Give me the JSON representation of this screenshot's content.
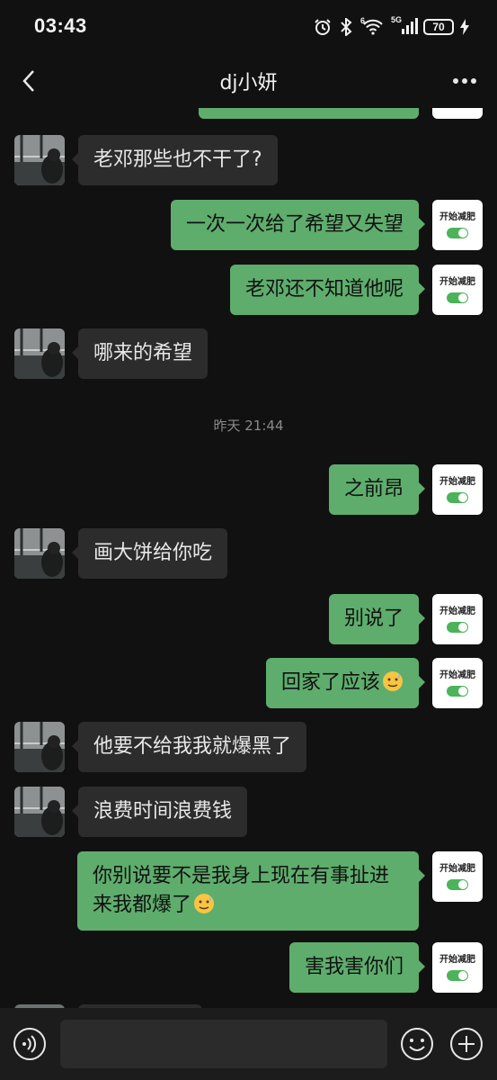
{
  "status_bar": {
    "time": "03:43",
    "signal_label": "5G",
    "wifi_label": "6",
    "battery_level": "70",
    "icons": [
      "alarm-icon",
      "bluetooth-icon",
      "wifi-icon",
      "cellular-signal-icon",
      "battery-icon",
      "charging-icon"
    ]
  },
  "header": {
    "title": "dj小妍",
    "back_icon": "chevron-left-icon",
    "more_icon": "more-dots-icon"
  },
  "contact_app_avatar": {
    "label": "开始减肥",
    "toggle_on": true
  },
  "messages": [
    {
      "side": "in",
      "text": "老邓那些也不干了?"
    },
    {
      "side": "out",
      "text": "一次一次给了希望又失望"
    },
    {
      "side": "out",
      "text": "老邓还不知道他呢"
    },
    {
      "side": "in",
      "text": "哪来的希望"
    },
    {
      "side": "out",
      "text": "之前昂"
    },
    {
      "side": "in",
      "text": "画大饼给你吃"
    },
    {
      "side": "out",
      "text": "别说了"
    },
    {
      "side": "out",
      "text": "回家了应该",
      "emoji": "sweat-smile-emoji"
    },
    {
      "side": "in",
      "text": "他要不给我我就爆黑了"
    },
    {
      "side": "in",
      "text": "浪费时间浪费钱"
    },
    {
      "side": "out",
      "text": "你别说要不是我身上现在有事扯进来我都爆了",
      "emoji": "sweat-smile-emoji"
    },
    {
      "side": "out",
      "text": "害我害你们"
    }
  ],
  "timestamp": "昨天 21:44",
  "input_bar": {
    "value": "",
    "voice_icon": "voice-icon",
    "emoji_icon": "smiley-icon",
    "plus_icon": "plus-icon"
  },
  "colors": {
    "background": "#111111",
    "incoming_bubble": "#2c2c2c",
    "outgoing_bubble": "#5ead6d",
    "input_bar": "#1c1c1c"
  }
}
